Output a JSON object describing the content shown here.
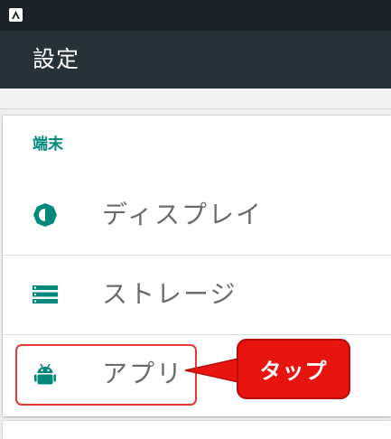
{
  "status_bar": {
    "notification_icon": "a-letter-icon"
  },
  "app_bar": {
    "title": "設定"
  },
  "section": {
    "category_label": "端末",
    "items": [
      {
        "label": "ディスプレイ",
        "icon": "brightness-icon"
      },
      {
        "label": "ストレージ",
        "icon": "storage-icon"
      },
      {
        "label": "アプリ",
        "icon": "android-icon"
      }
    ]
  },
  "annotation": {
    "callout_text": "タップ"
  },
  "colors": {
    "status_bar": "#1c2227",
    "app_bar": "#263238",
    "accent": "#00897b",
    "item_text": "#6b6b6b",
    "callout": "#e8140f",
    "highlight_border": "#e53935"
  }
}
